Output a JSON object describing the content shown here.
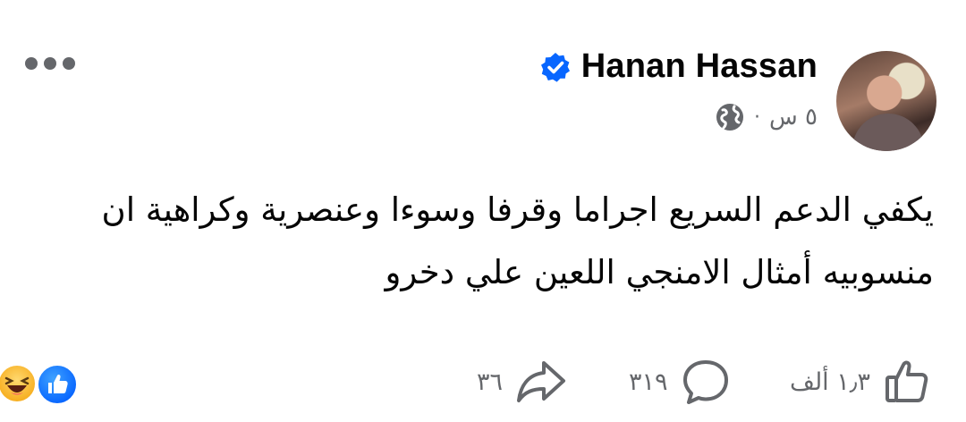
{
  "post": {
    "author": {
      "name": "Hanan Hassan",
      "verified": true
    },
    "meta": {
      "time": "٥ س",
      "separator": "·",
      "audience_icon": "globe-icon"
    },
    "more_icon": "more-options-icon",
    "text_lines": [
      "يكفي الدعم السريع اجراما وقرفا وسوءا وعنصرية وكراهية  ان",
      "منسوبيه أمثال الامنجي اللعين علي دخرو"
    ],
    "reactions": {
      "types": [
        "haha-icon",
        "like-icon"
      ]
    },
    "actions": {
      "like_count": "١٫٣ ألف",
      "comment_count": "٣١٩",
      "share_count": "٣٦"
    },
    "colors": {
      "accent": "#0866ff",
      "secondary_text": "#65676b",
      "primary_text": "#050505",
      "haha": "#f7b125"
    }
  }
}
